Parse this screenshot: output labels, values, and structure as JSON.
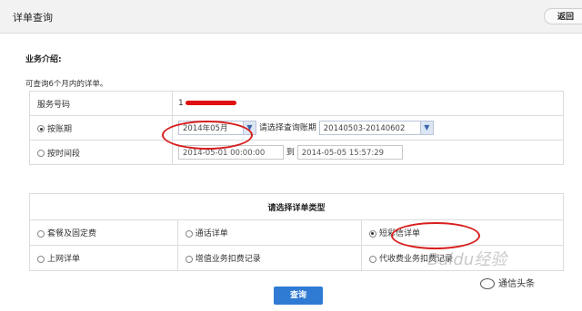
{
  "header": {
    "title": "详单查询",
    "back_label": "返回"
  },
  "intro": {
    "heading": "业务介绍:",
    "text": "可查询6个月内的详单。"
  },
  "query_form": {
    "phone_label": "服务号码",
    "phone_visible_prefix": "1",
    "by_period": {
      "label": "按账期",
      "selected": true,
      "month_value": "2014年05月",
      "period_prompt": "请选择查询账期",
      "period_value": "20140503-20140602"
    },
    "by_time": {
      "label": "按时间段",
      "selected": false,
      "start_value": "2014-05-01 00:00:00",
      "to_label": "到",
      "end_value": "2014-05-05 15:57:29"
    }
  },
  "detail_types": {
    "header": "请选择详单类型",
    "options": [
      {
        "label": "套餐及固定费",
        "selected": false
      },
      {
        "label": "通话详单",
        "selected": false
      },
      {
        "label": "短彩信详单",
        "selected": true
      },
      {
        "label": "上网详单",
        "selected": false
      },
      {
        "label": "增值业务扣费记录",
        "selected": false
      },
      {
        "label": "代收费业务扣费记录",
        "selected": false
      }
    ]
  },
  "actions": {
    "query_label": "查询"
  },
  "overlay": {
    "watermark": "Baidu经验",
    "brand": "通信头条"
  },
  "colors": {
    "accent": "#2f7bd3",
    "highlight": "#d81e1e",
    "border": "#dcdcdc"
  }
}
